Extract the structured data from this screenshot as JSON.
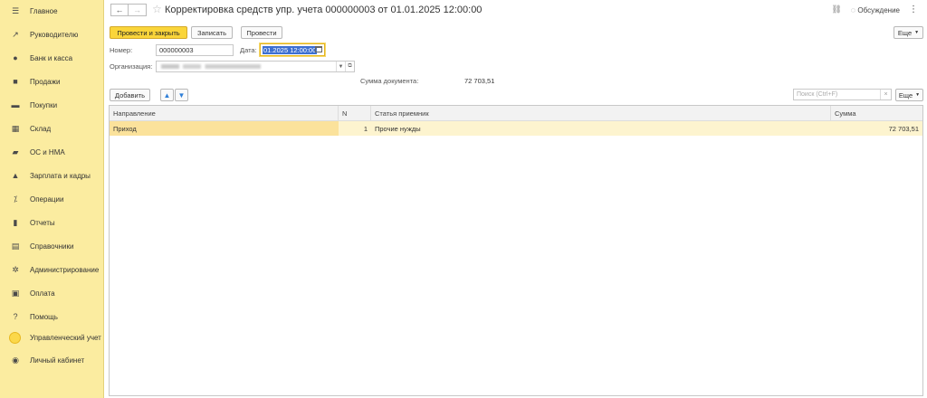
{
  "sidebar": {
    "items": [
      {
        "label": "Главное",
        "icon": "menu-icon"
      },
      {
        "label": "Руководителю",
        "icon": "trend-icon"
      },
      {
        "label": "Банк и касса",
        "icon": "coin-icon"
      },
      {
        "label": "Продажи",
        "icon": "bag-icon"
      },
      {
        "label": "Покупки",
        "icon": "cart-icon"
      },
      {
        "label": "Склад",
        "icon": "warehouse-icon"
      },
      {
        "label": "ОС и НМА",
        "icon": "truck-icon"
      },
      {
        "label": "Зарплата и кадры",
        "icon": "person-icon"
      },
      {
        "label": "Операции",
        "icon": "operations-icon"
      },
      {
        "label": "Отчеты",
        "icon": "bar-chart-icon"
      },
      {
        "label": "Справочники",
        "icon": "books-icon"
      },
      {
        "label": "Администрирование",
        "icon": "gear-icon"
      },
      {
        "label": "Оплата",
        "icon": "payment-icon"
      },
      {
        "label": "Помощь",
        "icon": "question-icon"
      },
      {
        "label": "Управленческий учет",
        "icon": "yellow-circle-icon"
      },
      {
        "label": "Личный кабинет",
        "icon": "account-icon"
      }
    ]
  },
  "header": {
    "back": "←",
    "forward": "→",
    "title": "Корректировка средств упр. учета 000000003 от 01.01.2025 12:00:00",
    "discussion": "Обсуждение",
    "more_dots": "⋮"
  },
  "toolbar": {
    "post_close": "Провести и закрыть",
    "save": "Записать",
    "post": "Провести",
    "more": "Еще"
  },
  "form": {
    "number_label": "Номер:",
    "number_value": "000000003",
    "date_label": "Дата:",
    "date_value": "01.2025 12:00:00",
    "org_label": "Организация:",
    "sum_label": "Сумма документа:",
    "sum_value": "72 703,51"
  },
  "table_toolbar": {
    "add": "Добавить",
    "search_placeholder": "Поиск (Ctrl+F)",
    "more": "Еще"
  },
  "table": {
    "columns": [
      "Направление",
      "N",
      "Статья приемник",
      "Сумма"
    ],
    "rows": [
      {
        "direction": "Приход",
        "n": "1",
        "article": "Прочие нужды",
        "sum": "72 703,51"
      }
    ]
  },
  "colors": {
    "sidebar_bg": "#fbeca0",
    "primary_button": "#fad53a",
    "selected_row": "#fdf4cf"
  }
}
